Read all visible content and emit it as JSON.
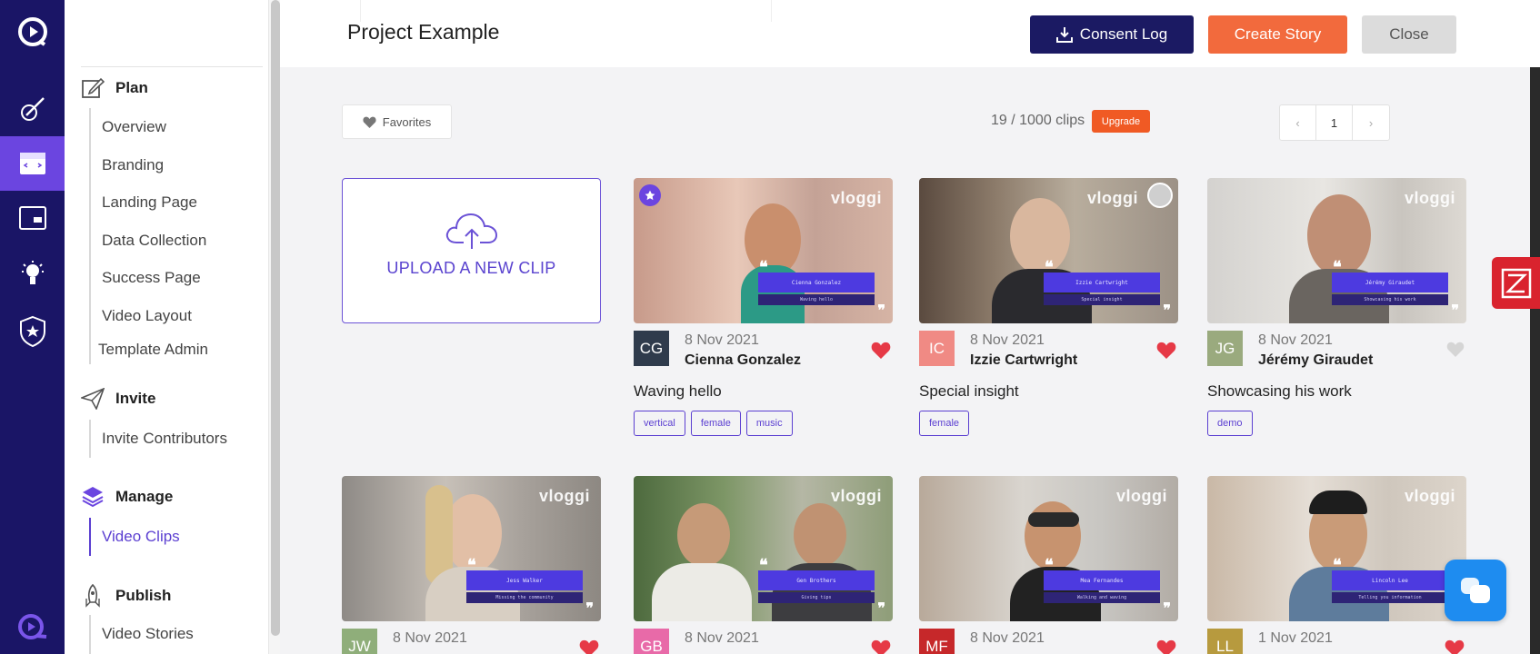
{
  "header": {
    "title": "Project Example",
    "consent_label": "Consent Log",
    "create_label": "Create Story",
    "close_label": "Close"
  },
  "sidebar": {
    "sections": [
      {
        "label": "Plan",
        "icon": "edit-icon",
        "items": [
          "Overview",
          "Branding",
          "Landing Page",
          "Data Collection",
          "Success Page",
          "Video Layout",
          "Template Admin"
        ]
      },
      {
        "label": "Invite",
        "icon": "paper-plane-icon",
        "items": [
          "Invite Contributors"
        ]
      },
      {
        "label": "Manage",
        "icon": "layers-icon",
        "items": [
          "Video Clips"
        ]
      },
      {
        "label": "Publish",
        "icon": "rocket-icon",
        "items": [
          "Video Stories"
        ]
      }
    ],
    "active_item": "Video Clips"
  },
  "rail": [
    "logo-icon",
    "brush-icon",
    "projects-icon",
    "screen-icon",
    "lightbulb-icon",
    "shield-star-icon",
    "brand-icon"
  ],
  "toolbar": {
    "favorites_label": "Favorites",
    "clips_count": "19 / 1000 clips",
    "upgrade_label": "Upgrade",
    "current_page": "1",
    "prev": "‹",
    "next": "›"
  },
  "upload": {
    "label": "UPLOAD A NEW CLIP"
  },
  "clips": [
    {
      "initials": "CG",
      "avatar_color": "#2f3b4c",
      "date": "8 Nov 2021",
      "name": "Cienna Gonzalez",
      "title": "Waving hello",
      "tags": [
        "vertical",
        "female",
        "music"
      ],
      "favorite": true,
      "starred": true,
      "banner": "Cienna Gonzalez",
      "subline": "Waving hello"
    },
    {
      "initials": "IC",
      "avatar_color": "#f08a84",
      "date": "8 Nov 2021",
      "name": "Izzie Cartwright",
      "title": "Special insight",
      "tags": [
        "female"
      ],
      "favorite": true,
      "selected_dot": true,
      "banner": "Izzie Cartwright",
      "subline": "Special insight"
    },
    {
      "initials": "JG",
      "avatar_color": "#9aaa7e",
      "date": "8 Nov 2021",
      "name": "Jérémy Giraudet",
      "title": "Showcasing his work",
      "tags": [
        "demo"
      ],
      "favorite": false,
      "banner": "Jérémy Giraudet",
      "subline": "Showcasing his work"
    },
    {
      "initials": "JW",
      "avatar_color": "#8fae7a",
      "date": "8 Nov 2021",
      "favorite": true,
      "banner": "Jess Walker",
      "subline": "Missing the community"
    },
    {
      "initials": "GB",
      "avatar_color": "#e86aa8",
      "date": "8 Nov 2021",
      "favorite": true,
      "banner": "Gen Brothers",
      "subline": "Giving tips"
    },
    {
      "initials": "MF",
      "avatar_color": "#c6282a",
      "date": "8 Nov 2021",
      "favorite": true,
      "banner": "Mea Fernandes",
      "subline": "Walking and waving"
    },
    {
      "initials": "LL",
      "avatar_color": "#b79a3e",
      "date": "1 Nov 2021",
      "favorite": true,
      "banner": "Lincoln Lee",
      "subline": "Telling you information"
    }
  ],
  "brand_text": "vloggi",
  "colors": {
    "primary": "#1a1566",
    "accent": "#6b45e0",
    "orange": "#f26a3d",
    "heart": "#e63946"
  }
}
